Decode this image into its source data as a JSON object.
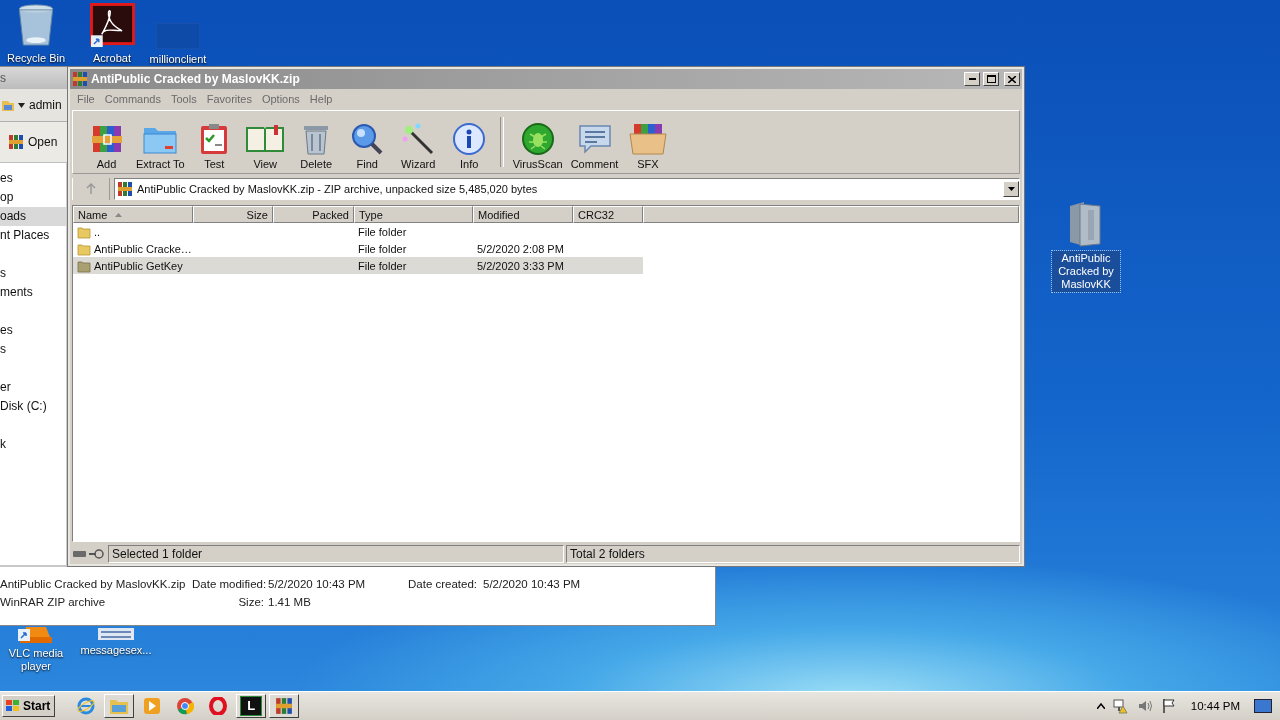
{
  "desktop_icons": [
    {
      "label": "Recycle Bin",
      "kind": "bin",
      "selected": false
    },
    {
      "label": "Acrobat",
      "kind": "pdf",
      "selected": false
    },
    {
      "label": "millionclient",
      "kind": "blank",
      "selected": false
    },
    {
      "label": "VLC media player",
      "kind": "cone",
      "selected": false
    },
    {
      "label": "messagesex...",
      "kind": "doc",
      "selected": false
    },
    {
      "label": "AntiPublic Cracked by MaslovKK",
      "kind": "zipfolder",
      "selected": true
    }
  ],
  "explorer": {
    "title": "s",
    "address": "admin",
    "toolbar_button": "Open",
    "nav_groups": [
      [
        {
          "label": "es",
          "selected": false
        },
        {
          "label": "op",
          "selected": false
        },
        {
          "label": "oads",
          "selected": true
        },
        {
          "label": "nt Places",
          "selected": false
        }
      ],
      [
        {
          "label": "s",
          "selected": false
        },
        {
          "label": "ments",
          "selected": false
        }
      ],
      [
        {
          "label": "es",
          "selected": false
        },
        {
          "label": "s",
          "selected": false
        }
      ],
      [
        {
          "label": "er",
          "selected": false
        },
        {
          "label": "Disk (C:)",
          "selected": false
        }
      ],
      [
        {
          "label": "k",
          "selected": false
        }
      ]
    ],
    "details": {
      "name": "AntiPublic Cracked by MaslovKK.zip",
      "type": "WinRAR ZIP archive",
      "modified_label": "Date modified:",
      "modified": "5/2/2020 10:43 PM",
      "created_label": "Date created:",
      "created": "5/2/2020 10:43 PM",
      "size_label": "Size:",
      "size": "1.41 MB"
    }
  },
  "winrar": {
    "title": "AntiPublic Cracked by MaslovKK.zip",
    "menu": [
      "File",
      "Commands",
      "Tools",
      "Favorites",
      "Options",
      "Help"
    ],
    "toolbar_groups": [
      [
        {
          "label": "Add",
          "kind": "add"
        },
        {
          "label": "Extract To",
          "kind": "extract"
        },
        {
          "label": "Test",
          "kind": "test"
        },
        {
          "label": "View",
          "kind": "view"
        },
        {
          "label": "Delete",
          "kind": "delete"
        },
        {
          "label": "Find",
          "kind": "find"
        },
        {
          "label": "Wizard",
          "kind": "wizard"
        },
        {
          "label": "Info",
          "kind": "info"
        }
      ],
      [
        {
          "label": "VirusScan",
          "kind": "virus"
        },
        {
          "label": "Comment",
          "kind": "comment"
        },
        {
          "label": "SFX",
          "kind": "sfx"
        }
      ]
    ],
    "address": "AntiPublic Cracked by MaslovKK.zip - ZIP archive, unpacked size 5,485,020 bytes",
    "columns": [
      {
        "label": "Name",
        "sorted": true
      },
      {
        "label": "Size",
        "sorted": false
      },
      {
        "label": "Packed",
        "sorted": false
      },
      {
        "label": "Type",
        "sorted": false
      },
      {
        "label": "Modified",
        "sorted": false
      },
      {
        "label": "CRC32",
        "sorted": false
      }
    ],
    "rows": [
      {
        "name": "..",
        "type": "File folder",
        "modified": "",
        "selected": false
      },
      {
        "name": "AntiPublic Cracke…",
        "type": "File folder",
        "modified": "5/2/2020 2:08 PM",
        "selected": false
      },
      {
        "name": "AntiPublic GetKey",
        "type": "File folder",
        "modified": "5/2/2020 3:33 PM",
        "selected": true
      }
    ],
    "status": {
      "left": "Selected 1 folder",
      "right": "Total 2 folders"
    }
  },
  "taskbar": {
    "start": "Start",
    "apps": [
      {
        "kind": "ie",
        "open": false
      },
      {
        "kind": "explorer",
        "open": true
      },
      {
        "kind": "media",
        "open": false
      },
      {
        "kind": "chrome",
        "open": false
      },
      {
        "kind": "opera",
        "open": false
      },
      {
        "kind": "terminal",
        "open": true,
        "label": "L"
      },
      {
        "kind": "winrar",
        "open": true
      }
    ],
    "clock": "10:44 PM"
  }
}
